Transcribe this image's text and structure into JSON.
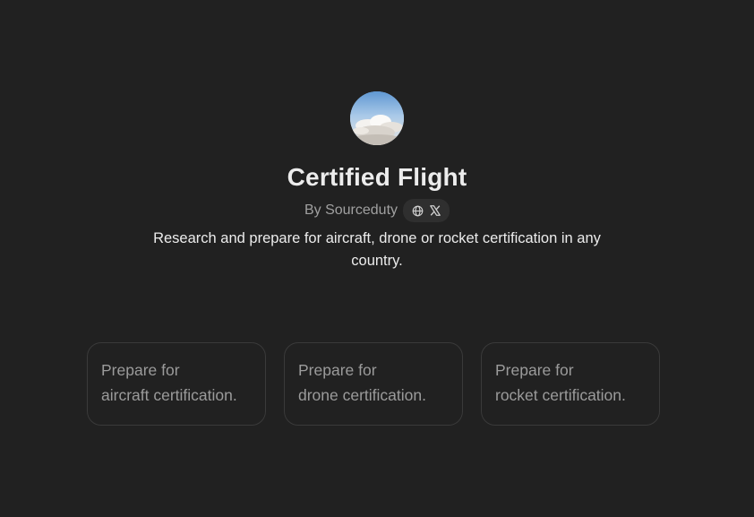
{
  "gpt": {
    "title": "Certified Flight",
    "author": "By Sourceduty",
    "description": "Research and prepare for aircraft, drone or rocket certification in any country.",
    "links": [
      "globe-icon",
      "x-icon"
    ]
  },
  "starters": [
    {
      "line1": "Prepare for",
      "line2": "aircraft certification."
    },
    {
      "line1": "Prepare for",
      "line2": "drone certification."
    },
    {
      "line1": "Prepare for",
      "line2": "rocket certification."
    }
  ],
  "colors": {
    "background": "#212121",
    "text": "#ececec",
    "muted": "#9b9b9b",
    "border": "#3a3a3a"
  }
}
